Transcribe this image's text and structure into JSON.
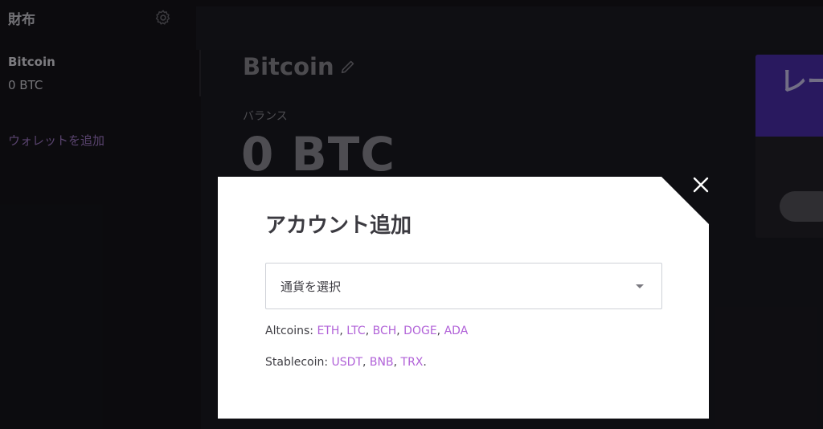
{
  "sidebar": {
    "title": "財布",
    "settings_icon": "gear-icon",
    "wallet": {
      "name": "Bitcoin",
      "balance": "0 BTC"
    },
    "add_wallet": "ウォレットを追加"
  },
  "main": {
    "coin_title": "Bitcoin",
    "edit_icon": "pencil-icon",
    "balance_label": "バランス",
    "balance_value": "0 BTC"
  },
  "promo": {
    "heading": "レー"
  },
  "modal": {
    "title": "アカウント追加",
    "select_placeholder": "通貨を選択",
    "altcoins_label": "Altcoins: ",
    "altcoins": [
      "ETH",
      "LTC",
      "BCH",
      "DOGE",
      "ADA"
    ],
    "stablecoin_label": "Stablecoin: ",
    "stablecoins": [
      "USDT",
      "BNB",
      "TRX"
    ],
    "close_icon": "close-icon"
  },
  "colors": {
    "background": "#16151b",
    "accent": "#b162d8",
    "promo": "#4b2fae",
    "modal": "#ffffff"
  }
}
